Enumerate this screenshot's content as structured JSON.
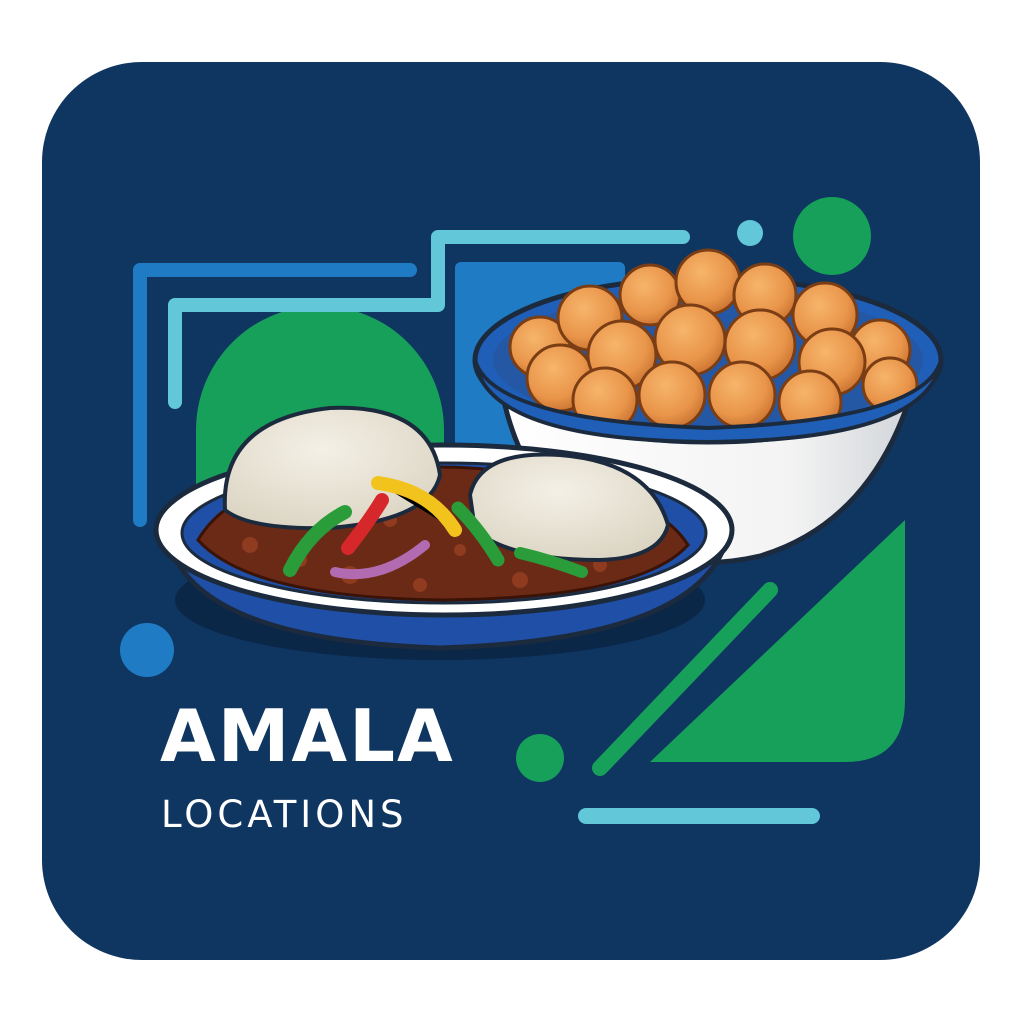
{
  "brand": {
    "title": "AMALA",
    "subtitle": "LOCATIONS"
  },
  "colors": {
    "background_page": "#ffffff",
    "tile": "#0f3561",
    "green": "#16a05a",
    "blue": "#1f7cc4",
    "cyan": "#62c7d8",
    "text": "#ffffff"
  },
  "icons": {
    "plate": "amala-plate-icon",
    "bowl": "puff-puff-bowl-icon"
  }
}
